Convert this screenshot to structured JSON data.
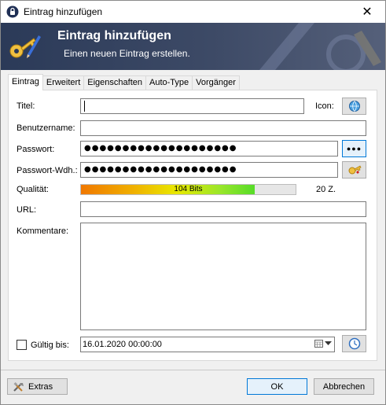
{
  "window": {
    "title": "Eintrag hinzufügen",
    "close_symbol": "✕"
  },
  "banner": {
    "title": "Eintrag hinzufügen",
    "subtitle": "Einen neuen Eintrag erstellen."
  },
  "tabs": [
    {
      "label": "Eintrag",
      "active": true
    },
    {
      "label": "Erweitert"
    },
    {
      "label": "Eigenschaften"
    },
    {
      "label": "Auto-Type"
    },
    {
      "label": "Vorgänger"
    }
  ],
  "form": {
    "title_label": "Titel:",
    "title_value": "",
    "icon_label": "Icon:",
    "username_label": "Benutzername:",
    "username_value": "",
    "password_label": "Passwort:",
    "password_value": "●●●●●●●●●●●●●●●●●●●●",
    "repeat_label": "Passwort-Wdh.:",
    "repeat_value": "●●●●●●●●●●●●●●●●●●●●",
    "reveal_button": "●●●",
    "quality_label": "Qualität:",
    "quality_text": "104 Bits",
    "quality_fraction": 0.81,
    "char_count": "20 Z.",
    "url_label": "URL:",
    "url_value": "",
    "notes_label": "Kommentare:",
    "notes_value": "",
    "expires_label": "Gültig bis:",
    "expires_checked": false,
    "expires_value": "16.01.2020 00:00:00"
  },
  "buttons": {
    "extras": "Extras",
    "ok": "OK",
    "cancel": "Abbrechen"
  },
  "colors": {
    "accent": "#0078d7",
    "banner": "#2b3a58"
  }
}
